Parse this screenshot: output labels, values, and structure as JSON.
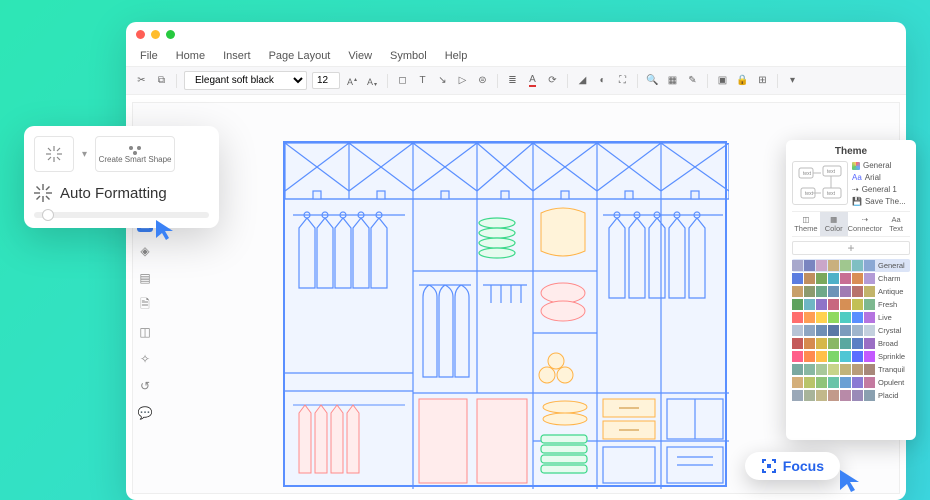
{
  "menu": {
    "items": [
      "File",
      "Home",
      "Insert",
      "Page Layout",
      "View",
      "Symbol",
      "Help"
    ]
  },
  "toolbar": {
    "font": "Elegant soft black",
    "size": "12"
  },
  "popup": {
    "smartShape": "Create Smart Shape",
    "autoFormat": "Auto Formatting"
  },
  "theme": {
    "title": "Theme",
    "opts": [
      "General",
      "Arial",
      "General 1",
      "Save The..."
    ],
    "tabs": [
      "Theme",
      "Color",
      "Connector",
      "Text"
    ],
    "rows": [
      "General",
      "Charm",
      "Antique",
      "Fresh",
      "Live",
      "Crystal",
      "Broad",
      "Sprinkle",
      "Tranquil",
      "Opulent",
      "Placid"
    ],
    "palettes": [
      [
        "#a8a8cc",
        "#7a85c0",
        "#caa6c9",
        "#c9b07e",
        "#a0c78f",
        "#7fbfc2",
        "#8aa8d4"
      ],
      [
        "#5b7de0",
        "#c08f5f",
        "#7aa85c",
        "#4fb1c8",
        "#c86f93",
        "#d98e55",
        "#b39bd6"
      ],
      [
        "#c8a06a",
        "#8c9b6e",
        "#6ea88a",
        "#6d94b8",
        "#a07cb3",
        "#b8736c",
        "#c2b46a"
      ],
      [
        "#5fa25f",
        "#6fb6c4",
        "#8f74c8",
        "#c8677f",
        "#d68f55",
        "#c2c055",
        "#7db88f"
      ],
      [
        "#ff6e6e",
        "#ff9e55",
        "#ffd24f",
        "#8fd95f",
        "#4fccc2",
        "#5a8fff",
        "#b574e0"
      ],
      [
        "#b7c4d6",
        "#8fa6c2",
        "#6f8fb5",
        "#5a78a5",
        "#7c9bbc",
        "#9fb5cc",
        "#c3d0de"
      ],
      [
        "#c45a5a",
        "#d68a4f",
        "#d6b74a",
        "#8ab765",
        "#5aa8a0",
        "#5a7fc4",
        "#9a6ec4"
      ],
      [
        "#ff5f8a",
        "#ff8a4f",
        "#ffc04a",
        "#7dd66a",
        "#4fc6d4",
        "#5a6eff",
        "#c45aff"
      ],
      [
        "#7aa8a0",
        "#88b8a2",
        "#a8c89a",
        "#c8d48a",
        "#c2b47a",
        "#b89c7a",
        "#a8887a"
      ],
      [
        "#d4af7a",
        "#b9c46a",
        "#8fc47a",
        "#6ac4a8",
        "#6aa0d4",
        "#8a7ad4",
        "#c47aa0"
      ],
      [
        "#9aa8b8",
        "#a8b49a",
        "#c2b88a",
        "#c29a8a",
        "#b88aa8",
        "#9a8ab8",
        "#8aa0b0"
      ]
    ]
  },
  "focus": {
    "label": "Focus"
  }
}
